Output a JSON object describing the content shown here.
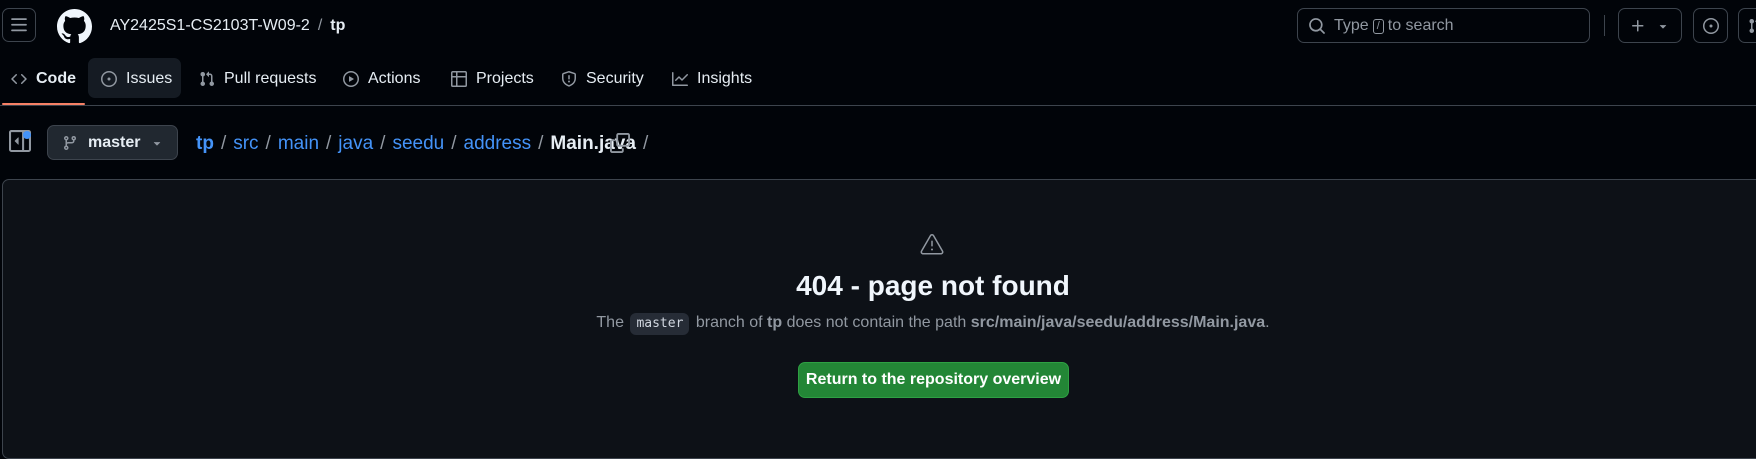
{
  "header": {
    "owner": "AY2425S1-CS2103T-W09-2",
    "separator": "/",
    "repo": "tp",
    "search": {
      "prefix": "Type",
      "key": "/",
      "suffix": "to search"
    }
  },
  "repo_nav": {
    "tabs": [
      {
        "label": "Code",
        "icon": "code-icon",
        "selected": true
      },
      {
        "label": "Issues",
        "icon": "issue-opened-icon"
      },
      {
        "label": "Pull requests",
        "icon": "git-pull-request-icon"
      },
      {
        "label": "Actions",
        "icon": "play-icon"
      },
      {
        "label": "Projects",
        "icon": "table-icon"
      },
      {
        "label": "Security",
        "icon": "shield-icon"
      },
      {
        "label": "Insights",
        "icon": "graph-icon"
      }
    ]
  },
  "file_header": {
    "branch": "master",
    "path": [
      "tp",
      "src",
      "main",
      "java",
      "seedu",
      "address"
    ],
    "current_file": "Main.java",
    "separator": "/"
  },
  "error": {
    "title": "404 - page not found",
    "desc_the": "The",
    "desc_branch": "master",
    "desc_branch_of": "branch of",
    "desc_repo": "tp",
    "desc_not_contain": "does not contain the path",
    "desc_path": "src/main/java/seedu/address/Main.java",
    "desc_end": ".",
    "button": "Return to the repository overview"
  },
  "colors": {
    "background": "#010409",
    "panel": "#0d1117",
    "border": "#3d444d",
    "link": "#4493f8",
    "primary_button": "#238636",
    "tab_underline": "#f78166"
  }
}
